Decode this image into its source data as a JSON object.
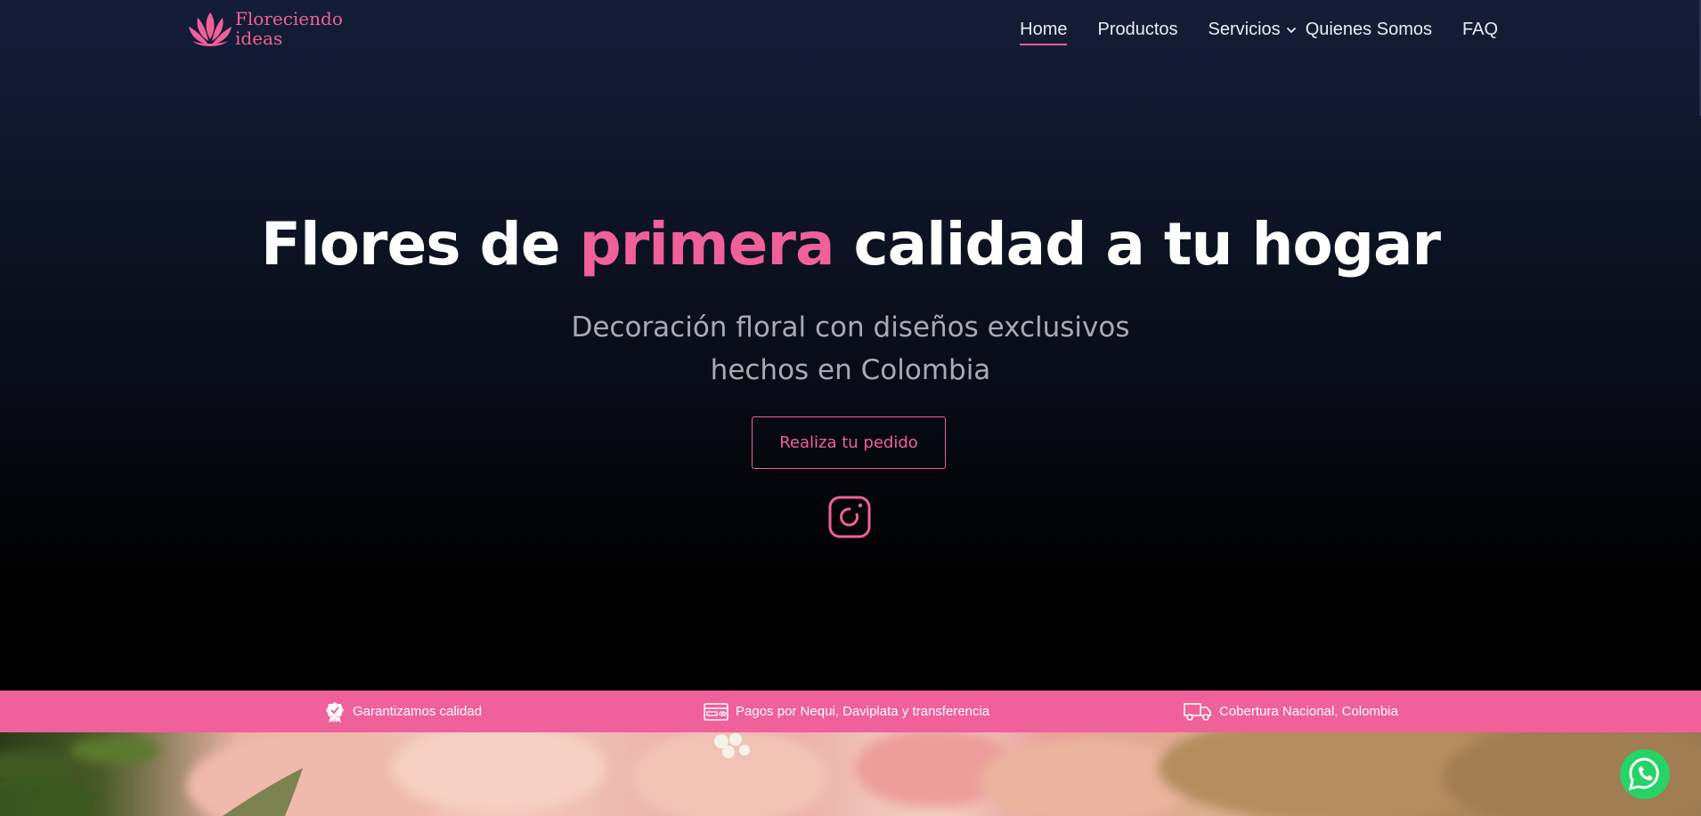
{
  "brand": {
    "line1": "Floreciendo",
    "line2": "ideas",
    "accent_color": "#f0609b",
    "logo_icon": "lotus-icon"
  },
  "nav": {
    "items": [
      {
        "label": "Home",
        "active": true
      },
      {
        "label": "Productos"
      },
      {
        "label": "Servicios",
        "has_dropdown": true
      },
      {
        "label": "Quienes Somos"
      },
      {
        "label": "FAQ"
      }
    ]
  },
  "hero": {
    "headline_part1": "Flores de ",
    "headline_accent": "primera",
    "headline_part2": " calidad a tu hogar",
    "subtitle_line1": "Decoración floral con diseños exclusivos",
    "subtitle_line2": "hechos en Colombia",
    "cta_label": "Realiza tu pedido",
    "social_icon": "instagram-icon"
  },
  "features": [
    {
      "icon": "award-icon",
      "label": "Garantizamos calidad"
    },
    {
      "icon": "credit-card-icon",
      "label": "Pagos por Nequi, Daviplata y transferencia"
    },
    {
      "icon": "truck-icon",
      "label": "Cobertura Nacional, Colombia"
    }
  ],
  "floating": {
    "icon": "whatsapp-icon"
  }
}
